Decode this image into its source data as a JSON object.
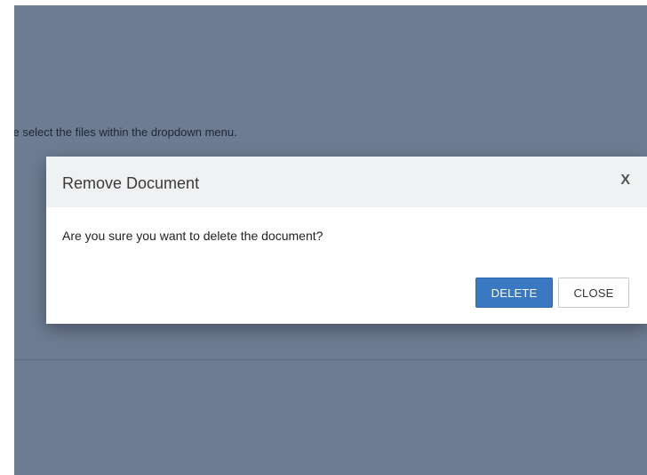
{
  "background": {
    "instruction_text": "se select the files within the dropdown menu."
  },
  "modal": {
    "title": "Remove Document",
    "close_icon_text": "X",
    "message": "Are you sure you want to delete the document?",
    "delete_label": "DELETE",
    "close_label": "CLOSE"
  },
  "colors": {
    "backdrop": "#6e7c93",
    "primary_button": "#3a78c2",
    "modal_header": "#f0f1f2"
  }
}
